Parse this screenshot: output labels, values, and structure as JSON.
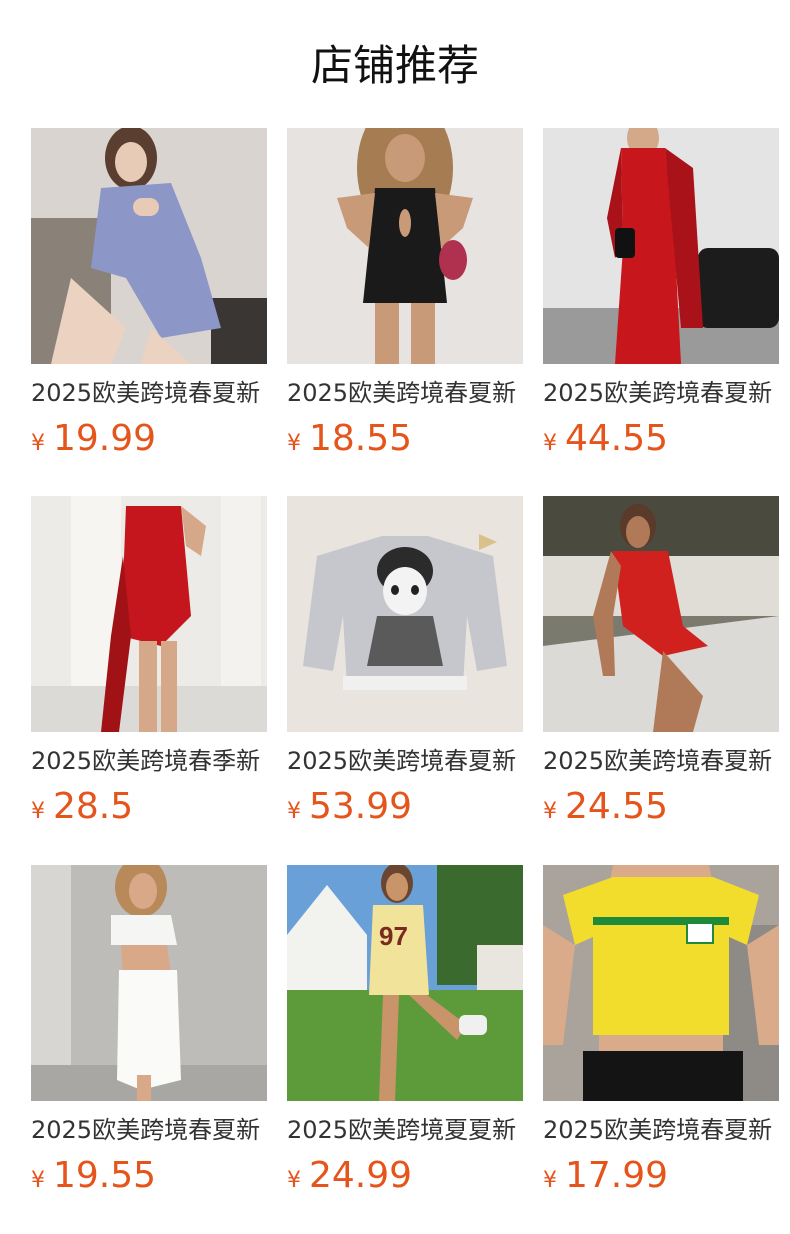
{
  "page": {
    "title": "店铺推荐"
  },
  "colors": {
    "price": "#e5541b",
    "title": "#111111",
    "text": "#333333"
  },
  "products": [
    {
      "title": "2025欧美跨境春夏新",
      "currency": "¥",
      "price": "19.99",
      "image": "woman-in-lavender-cutout-dress"
    },
    {
      "title": "2025欧美跨境春夏新",
      "currency": "¥",
      "price": "18.55",
      "image": "woman-in-black-keyhole-mini-dress"
    },
    {
      "title": "2025欧美跨境春夏新",
      "currency": "¥",
      "price": "44.55",
      "image": "woman-in-red-long-sleeve-maxi-dress"
    },
    {
      "title": "2025欧美跨境春季新",
      "currency": "¥",
      "price": "28.5",
      "image": "woman-in-red-draped-asymmetric-dress"
    },
    {
      "title": "2025欧美跨境春夏新",
      "currency": "¥",
      "price": "53.99",
      "image": "grey-graphic-sweater-flat-lay"
    },
    {
      "title": "2025欧美跨境春夏新",
      "currency": "¥",
      "price": "24.55",
      "image": "woman-in-red-strappy-mini-dress"
    },
    {
      "title": "2025欧美跨境春夏新",
      "currency": "¥",
      "price": "19.55",
      "image": "woman-in-white-cutout-maxi-dress"
    },
    {
      "title": "2025欧美跨境夏夏新",
      "currency": "¥",
      "price": "24.99",
      "image": "woman-in-yellow-jersey-dress"
    },
    {
      "title": "2025欧美跨境春夏新",
      "currency": "¥",
      "price": "17.99",
      "image": "yellow-crop-tee"
    }
  ]
}
